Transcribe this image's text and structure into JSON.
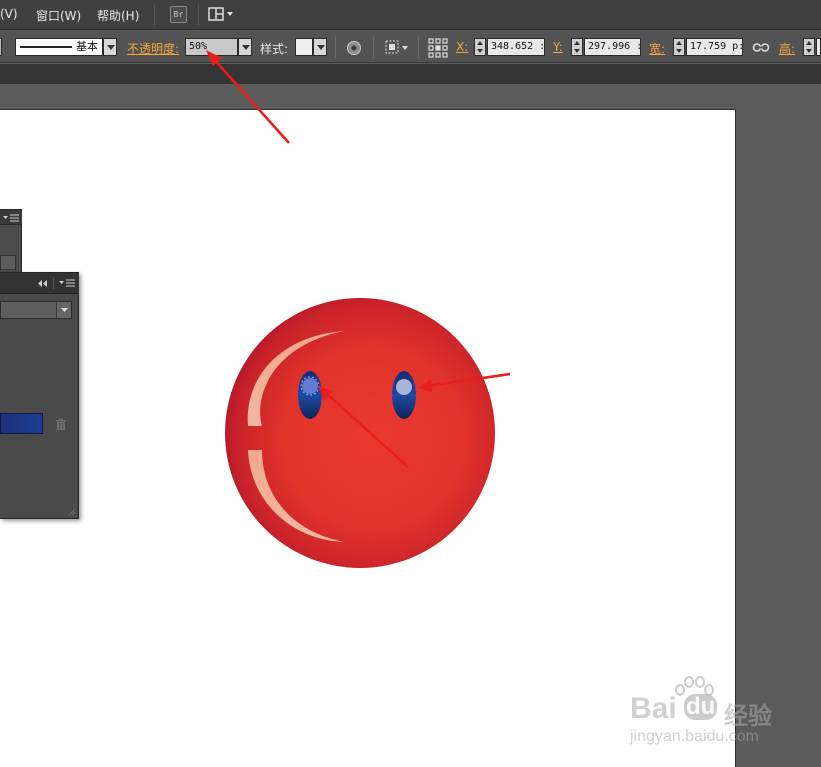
{
  "menubar": {
    "items": [
      {
        "label": "(V)"
      },
      {
        "label": "窗口(W)"
      },
      {
        "label": "帮助(H)"
      }
    ],
    "bridge_label": "Br"
  },
  "controlbar": {
    "stroke_profile": "基本",
    "opacity_label": "不透明度:",
    "opacity_value": "50%",
    "style_label": "样式:",
    "x_label": "X:",
    "x_value": "348.652 :",
    "y_label": "Y:",
    "y_value": "297.996 :",
    "width_label": "宽:",
    "width_value": "17.759 p:",
    "height_label": "高:"
  },
  "watermark": {
    "logo_text": "Bai",
    "logo_text2": "du",
    "brand": "经验",
    "url": "jingyan.baidu.com"
  },
  "colors": {
    "ui_dark": "#404040",
    "ui_mid": "#535353",
    "accent_label": "#f4a640",
    "annotation_arrow": "#e81e1e",
    "face_red": "#e2332b",
    "eye_blue": "#1b3f94"
  }
}
